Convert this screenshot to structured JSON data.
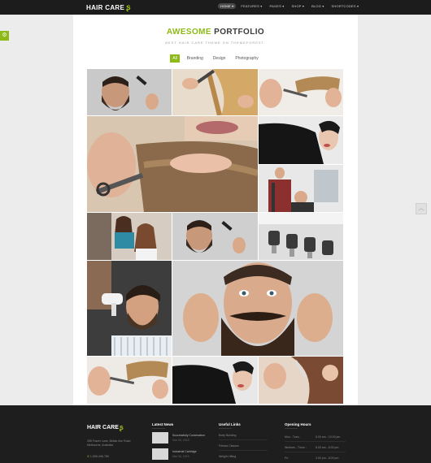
{
  "header": {
    "logo": "HAIR CARE",
    "nav": [
      {
        "label": "HOME ▾",
        "active": true
      },
      {
        "label": "FEATURES ▾",
        "active": false
      },
      {
        "label": "PAGES ▾",
        "active": false
      },
      {
        "label": "SHOP ▾",
        "active": false
      },
      {
        "label": "BLOG ▾",
        "active": false
      },
      {
        "label": "SHORTCODES ▾",
        "active": false
      }
    ]
  },
  "side_tab": {
    "icon": "settings-icon"
  },
  "scroll_top": {
    "icon": "chevron-up-icon"
  },
  "portfolio": {
    "title_accent": "AWESOME",
    "title_rest": "PORTFOLIO",
    "subtitle": "BEST HAIR CARE THEME ON THEMEFOREST.",
    "filters": [
      {
        "label": "All",
        "active": true
      },
      {
        "label": "Branding",
        "active": false
      },
      {
        "label": "Design",
        "active": false
      },
      {
        "label": "Photography",
        "active": false
      }
    ]
  },
  "footer": {
    "logo": "HAIR CARE",
    "address": "285 Frazer Lane, Bellair Ave Road Melbourne, Australia",
    "phone": "1-555-496-789",
    "latest_news": {
      "heading": "Latest News",
      "items": [
        {
          "title": "Successfully Construction",
          "date": "Mar 06, 2015"
        },
        {
          "title": "Industrial Cartridge",
          "date": "Mar 06, 2015"
        }
      ]
    },
    "useful_links": {
      "heading": "Useful Links",
      "items": [
        "Body Building",
        "Fitness Classes",
        "Weight Lifting"
      ]
    },
    "opening_hours": {
      "heading": "Opening Hours",
      "rows": [
        {
          "day": "Mon - Tues :",
          "time": "6.00 am - 10.00 pm"
        },
        {
          "day": "Wednes - Thurs :",
          "time": "8.00 am - 6.00 pm"
        },
        {
          "day": "Fri :",
          "time": "3.00 pm - 8.00 pm"
        }
      ]
    }
  }
}
